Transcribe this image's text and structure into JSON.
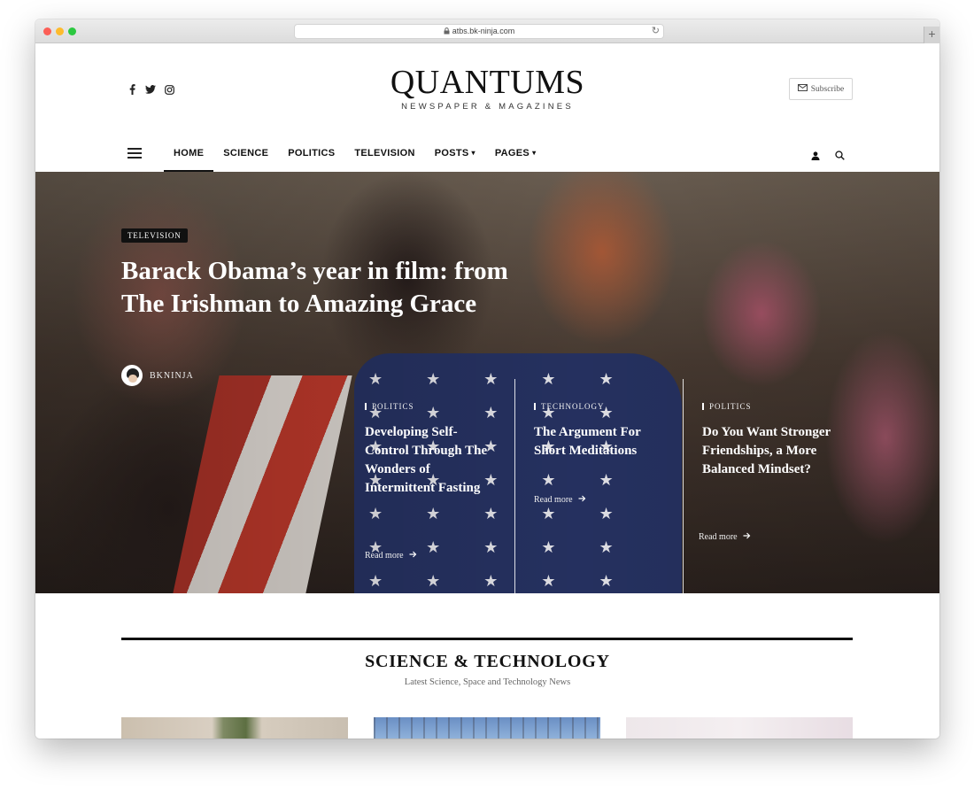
{
  "browser": {
    "url": "atbs.bk-ninja.com",
    "new_tab": "+"
  },
  "site": {
    "logo": "QUANTUMS",
    "tagline": "NEWSPAPER & MAGAZINES",
    "subscribe_label": "Subscribe"
  },
  "social": [
    "facebook-icon",
    "twitter-icon",
    "instagram-icon"
  ],
  "nav": {
    "items": [
      {
        "label": "HOME",
        "active": true
      },
      {
        "label": "SCIENCE"
      },
      {
        "label": "POLITICS"
      },
      {
        "label": "TELEVISION"
      },
      {
        "label": "POSTS",
        "dropdown": true
      },
      {
        "label": "PAGES",
        "dropdown": true
      }
    ]
  },
  "hero": {
    "category": "TELEVISION",
    "title": "Barack Obama’s year in film: from The Irishman to Amazing Grace",
    "author": "BKNINJA",
    "posts": [
      {
        "category": "POLITICS",
        "title": "Developing Self-Control Through The Wonders of Intermittent Fasting",
        "more": "Read more"
      },
      {
        "category": "TECHNOLOGY",
        "title": "The Argument For Short Meditations",
        "more": "Read more"
      },
      {
        "category": "POLITICS",
        "title": "Do You Want Stronger Friendships, a More Balanced Mindset?",
        "more": "Read more"
      }
    ]
  },
  "section": {
    "title": "SCIENCE & TECHNOLOGY",
    "subtitle": "Latest Science, Space and Technology News"
  }
}
